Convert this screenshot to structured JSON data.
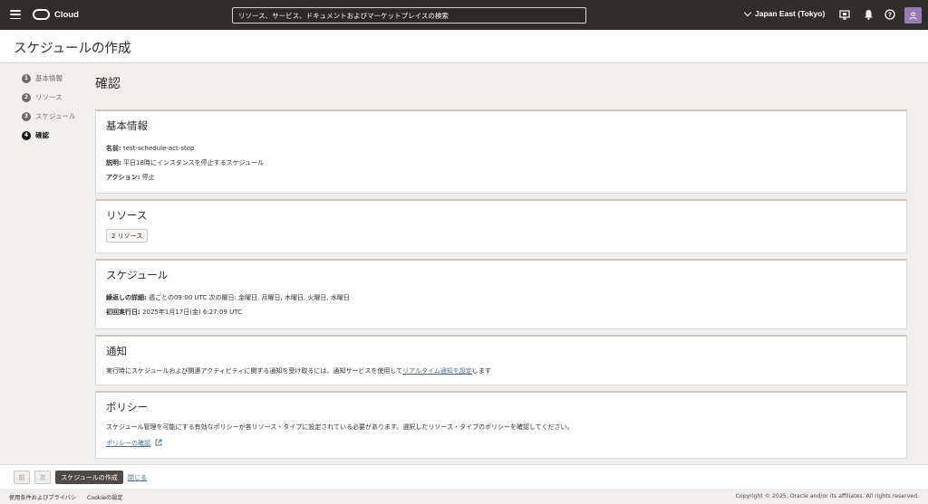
{
  "header": {
    "brand": "Cloud",
    "search_placeholder": "リソース、サービス、ドキュメントおよびマーケットプレイスの検索",
    "region": "Japan East (Tokyo)",
    "icons": [
      "menu-icon",
      "developer-tools-icon",
      "bell-icon",
      "help-icon",
      "profile-icon"
    ]
  },
  "page": {
    "title": "スケジュールの作成"
  },
  "steps": [
    {
      "num": "1",
      "label": "基本情報",
      "active": false
    },
    {
      "num": "2",
      "label": "リソース",
      "active": false
    },
    {
      "num": "3",
      "label": "スケジュール",
      "active": false
    },
    {
      "num": "4",
      "label": "確認",
      "active": true
    }
  ],
  "main": {
    "title": "確認",
    "basic": {
      "heading": "基本情報",
      "name_label": "名前:",
      "name_value": "test-schedule-act-stop",
      "desc_label": "説明:",
      "desc_value": "平日18時にインスタンスを停止するスケジュール",
      "action_label": "アクション:",
      "action_value": "停止"
    },
    "resources": {
      "heading": "リソース",
      "count_tag": "2 リソース"
    },
    "schedule": {
      "heading": "スケジュール",
      "repeat_label": "繰返しの詳細:",
      "repeat_value": "週ごとの09:00 UTC 次の曜日: 金曜日, 月曜日, 木曜日, 火曜日, 水曜日",
      "first_label": "初回実行日:",
      "first_value": "2025年1月17日(金) 6:27:09 UTC"
    },
    "notification": {
      "heading": "通知",
      "text_before": "実行時にスケジュールおよび関連アクティビティに関する通知を受け取るには、通知サービスを使用して",
      "link": "リアルタイム通知を設定",
      "text_after": "します"
    },
    "policy": {
      "heading": "ポリシー",
      "text": "スケジュール管理を可能にする有効なポリシーが各リソース・タイプに設定されている必要があります。選択したリソース・タイプのポリシーを確認してください。",
      "link": "ポリシーの確認"
    }
  },
  "actions": {
    "prev": "前",
    "next": "次",
    "create": "スケジュールの作成",
    "close": "閉じる"
  },
  "footer": {
    "terms": "使用条件およびプライバシ",
    "cookie": "Cookieの設定",
    "copyright": "Copyright © 2025, Oracle and/or its affiliates. All rights reserved."
  }
}
